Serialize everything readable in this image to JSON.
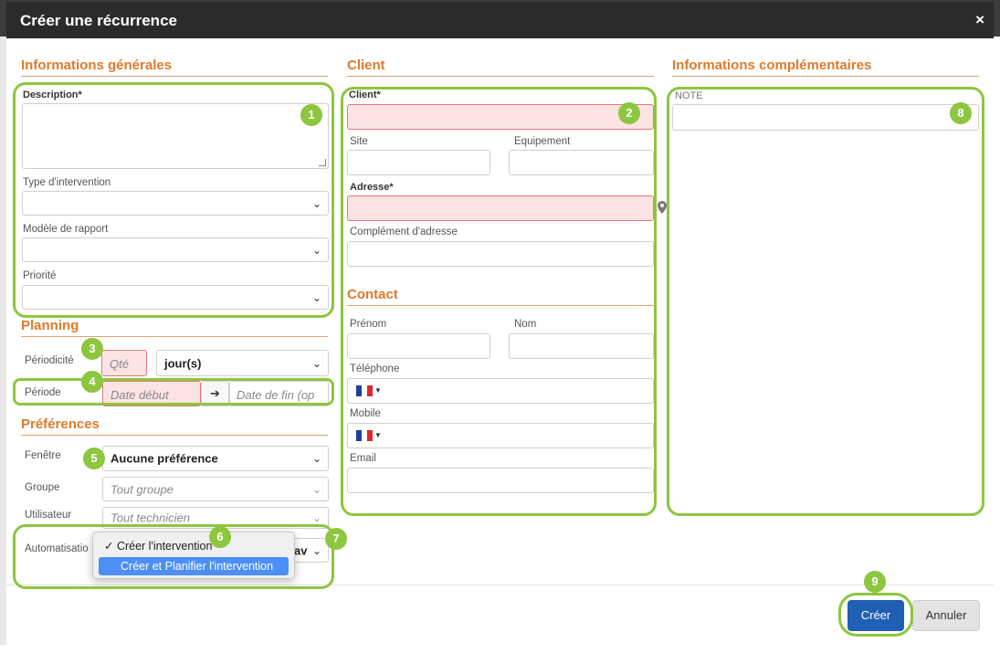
{
  "modal": {
    "title": "Créer une récurrence",
    "close_glyph": "×"
  },
  "sections": {
    "general": "Informations générales",
    "client": "Client",
    "extra": "Informations complémentaires",
    "planning": "Planning",
    "preferences": "Préférences",
    "contact": "Contact"
  },
  "general": {
    "description_label": "Description*",
    "type_label": "Type d'intervention",
    "report_label": "Modèle de rapport",
    "priority_label": "Priorité"
  },
  "planning": {
    "periodicity_label": "Périodicité",
    "qty_placeholder": "Qté",
    "unit_value": "jour(s)",
    "period_label": "Période",
    "start_placeholder": "Date début",
    "arrow": "➔",
    "end_placeholder": "Date de fin (op"
  },
  "preferences": {
    "window_label": "Fenêtre",
    "window_value": "Aucune préférence",
    "group_label": "Groupe",
    "group_placeholder": "Tout groupe",
    "user_label": "Utilisateur",
    "user_placeholder": "Tout technicien",
    "automation_label": "Automatisatio",
    "automation_tail": "av",
    "dropdown": [
      {
        "label": "✓ Créer l'intervention",
        "selected": false
      },
      {
        "label": "Créer et Planifier l'intervention",
        "selected": true
      }
    ]
  },
  "client": {
    "client_label": "Client*",
    "site_label": "Site",
    "equipment_label": "Equipement",
    "address_label": "Adresse*",
    "address_complement_label": "Complément d'adresse"
  },
  "contact": {
    "firstname_label": "Prénom",
    "lastname_label": "Nom",
    "phone_label": "Téléphone",
    "mobile_label": "Mobile",
    "email_label": "Email",
    "flag_colors": [
      "#1f3f9f",
      "#ffffff",
      "#e0262e"
    ]
  },
  "extra": {
    "note_label": "NOTE"
  },
  "footer": {
    "create_label": "Créer",
    "cancel_label": "Annuler"
  },
  "callouts": [
    "1",
    "2",
    "3",
    "4",
    "5",
    "6",
    "7",
    "8",
    "9"
  ],
  "colors": {
    "accent": "#e07a2a",
    "callout": "#8dc63f",
    "primary": "#1f5fb4",
    "error_fill": "#fde3e3"
  },
  "icons": {
    "chevron": "chevron-down-icon",
    "pin": "map-pin-icon",
    "close": "close-icon"
  }
}
